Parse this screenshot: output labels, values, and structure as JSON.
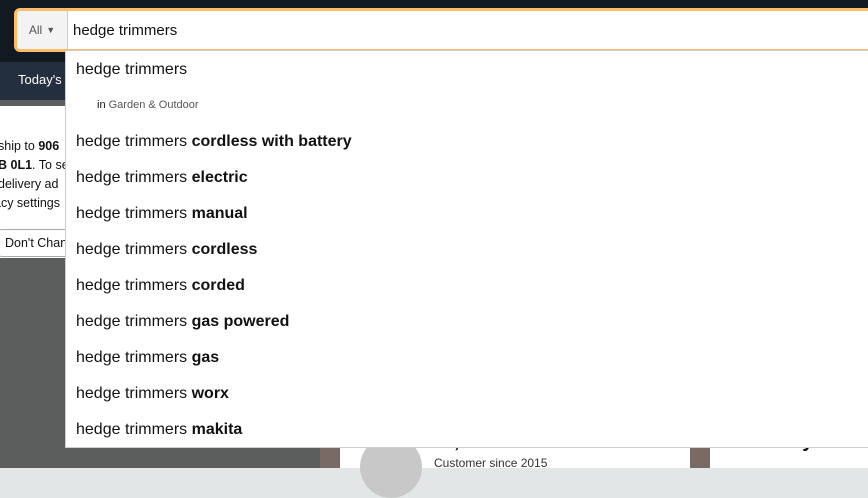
{
  "search": {
    "category": "All",
    "query": "hedge trimmers"
  },
  "subnav": {
    "first_item": "Today's"
  },
  "location_popover": {
    "line1_prefix": "ship to ",
    "line1_bold": "906",
    "line2_bold": "B 0L1",
    "line2_rest": ". To se",
    "line3": "delivery ad",
    "line4": "acy settings",
    "dont_change": "Don't Chan"
  },
  "suggestions": {
    "top": "hedge trimmers",
    "department_in": "in",
    "department": "Garden & Outdoor",
    "items": [
      {
        "base": "hedge trimmers ",
        "bold": "cordless with battery"
      },
      {
        "base": "hedge trimmers ",
        "bold": "electric"
      },
      {
        "base": "hedge trimmers ",
        "bold": "manual"
      },
      {
        "base": "hedge trimmers ",
        "bold": "cordless"
      },
      {
        "base": "hedge trimmers ",
        "bold": "corded"
      },
      {
        "base": "hedge trimmers ",
        "bold": "gas powered"
      },
      {
        "base": "hedge trimmers ",
        "bold": "gas"
      },
      {
        "base": "hedge trimmers ",
        "bold": "worx"
      },
      {
        "base": "hedge trimmers ",
        "bold": "makita"
      }
    ]
  },
  "background_cards": {
    "greeting": "Hi, Travis",
    "customer_since": "Customer since 2015",
    "recently_viewed": "Recently view"
  },
  "colors": {
    "header_bg": "#131921",
    "subnav_bg": "#232f3e",
    "search_focus": "#febd69"
  }
}
